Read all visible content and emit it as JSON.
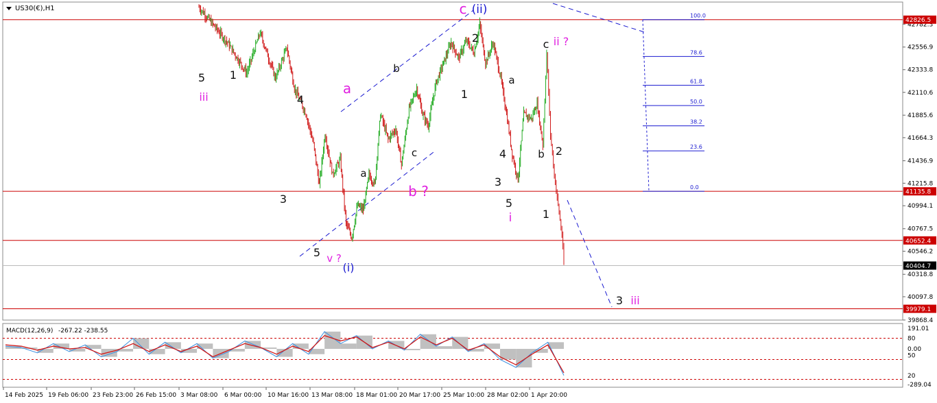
{
  "chart_data": {
    "type": "candlestick",
    "symbol_label": "US30(€),H1",
    "price_axis": {
      "min": 39868,
      "max": 43000,
      "tick_labels": [
        "42782.3",
        "42556.9",
        "42333.8",
        "42110.6",
        "41885.6",
        "41664.3",
        "41436.9",
        "41215.8",
        "40994.1",
        "40767.5",
        "40546.2",
        "40318.8",
        "40097.8",
        "39868.4"
      ]
    },
    "time_axis": {
      "labels": [
        "14 Feb 2025",
        "19 Feb 06:00",
        "23 Feb 23:00",
        "26 Feb 15:00",
        "3 Mar 08:00",
        "6 Mar 00:00",
        "10 Mar 16:00",
        "13 Mar 08:00",
        "18 Mar 01:00",
        "20 Mar 17:00",
        "25 Mar 10:00",
        "28 Mar 02:00",
        "1 Apr 20:00"
      ]
    },
    "horizontal_levels": [
      {
        "price": 42826.5,
        "label": "42826.5",
        "color": "#cc0000"
      },
      {
        "price": 41135.8,
        "label": "41135.8",
        "color": "#cc0000"
      },
      {
        "price": 40652.4,
        "label": "40652.4",
        "color": "#cc0000"
      },
      {
        "price": 39979.1,
        "label": "39979.1",
        "color": "#cc0000"
      }
    ],
    "current_price": {
      "price": 40404.7,
      "label": "40404.7"
    },
    "fibonacci": {
      "levels": [
        {
          "ratio": "100.0",
          "price": 42826.5
        },
        {
          "ratio": "78.6",
          "price": 42464.6
        },
        {
          "ratio": "61.8",
          "price": 42180.5
        },
        {
          "ratio": "50.0",
          "price": 41981.1
        },
        {
          "ratio": "38.2",
          "price": 41781.2
        },
        {
          "ratio": "23.6",
          "price": 41534.3
        },
        {
          "ratio": "0.0",
          "price": 41135.8
        }
      ]
    },
    "wave_labels": [
      {
        "text": "5",
        "color": "#111111"
      },
      {
        "text": "iii",
        "color": "#e020e0"
      },
      {
        "text": "1",
        "color": "#111111"
      },
      {
        "text": "4",
        "color": "#111111"
      },
      {
        "text": "3",
        "color": "#111111"
      },
      {
        "text": "5",
        "color": "#111111"
      },
      {
        "text": "v ?",
        "color": "#e020e0"
      },
      {
        "text": "(i)",
        "color": "#1a1ad0"
      },
      {
        "text": "a",
        "color": "#e020e0"
      },
      {
        "text": "a",
        "color": "#111111"
      },
      {
        "text": "b",
        "color": "#111111"
      },
      {
        "text": "c",
        "color": "#111111"
      },
      {
        "text": "b ?",
        "color": "#e020e0"
      },
      {
        "text": "c",
        "color": "#e020e0"
      },
      {
        "text": "(ii)",
        "color": "#1a1ad0"
      },
      {
        "text": "2",
        "color": "#111111"
      },
      {
        "text": "1",
        "color": "#111111"
      },
      {
        "text": "a",
        "color": "#111111"
      },
      {
        "text": "4",
        "color": "#111111"
      },
      {
        "text": "3",
        "color": "#111111"
      },
      {
        "text": "5",
        "color": "#111111"
      },
      {
        "text": "i",
        "color": "#e020e0"
      },
      {
        "text": "c",
        "color": "#111111"
      },
      {
        "text": "ii ?",
        "color": "#e020e0"
      },
      {
        "text": "b",
        "color": "#111111"
      },
      {
        "text": "2",
        "color": "#111111"
      },
      {
        "text": "1",
        "color": "#111111"
      },
      {
        "text": "3",
        "color": "#111111"
      },
      {
        "text": "iii",
        "color": "#e020e0"
      }
    ],
    "price_path": [
      [
        0.0,
        42950
      ],
      [
        1.5,
        42600
      ],
      [
        2.5,
        42300
      ],
      [
        3.2,
        42700
      ],
      [
        4.0,
        42250
      ],
      [
        4.6,
        42550
      ],
      [
        5.0,
        42150
      ],
      [
        5.6,
        41900
      ],
      [
        6.0,
        41600
      ],
      [
        6.3,
        41200
      ],
      [
        6.6,
        41700
      ],
      [
        7.0,
        41300
      ],
      [
        7.4,
        41450
      ],
      [
        7.7,
        40820
      ],
      [
        8.0,
        40680
      ],
      [
        8.3,
        41000
      ],
      [
        8.6,
        40950
      ],
      [
        8.9,
        41300
      ],
      [
        9.2,
        41200
      ],
      [
        9.5,
        41900
      ],
      [
        9.9,
        41650
      ],
      [
        10.3,
        41750
      ],
      [
        10.6,
        41400
      ],
      [
        11.0,
        41950
      ],
      [
        11.4,
        42150
      ],
      [
        11.7,
        41900
      ],
      [
        12.0,
        41780
      ],
      [
        12.4,
        42200
      ],
      [
        12.8,
        42400
      ],
      [
        13.2,
        42600
      ],
      [
        13.6,
        42450
      ],
      [
        14.0,
        42620
      ],
      [
        14.4,
        42500
      ],
      [
        14.7,
        42780
      ],
      [
        15.0,
        42400
      ],
      [
        15.4,
        42600
      ],
      [
        15.8,
        42250
      ],
      [
        16.1,
        41900
      ],
      [
        16.4,
        41500
      ],
      [
        16.7,
        41250
      ],
      [
        17.0,
        41900
      ],
      [
        17.4,
        41850
      ],
      [
        17.7,
        42000
      ],
      [
        18.0,
        41600
      ],
      [
        18.2,
        42500
      ],
      [
        18.4,
        41700
      ],
      [
        18.6,
        41300
      ],
      [
        18.8,
        41000
      ],
      [
        19.0,
        40700
      ],
      [
        19.1,
        40420
      ]
    ],
    "indicator": {
      "name": "MACD(12,26,9)",
      "values_label": "-267.22 -238.55",
      "scale_labels": [
        "191.01",
        "80",
        "0.00",
        "50",
        "20",
        "-289.04"
      ],
      "main_line": [
        20,
        10,
        -30,
        40,
        -20,
        30,
        -60,
        -20,
        80,
        -40,
        50,
        -30,
        40,
        -70,
        -20,
        60,
        10,
        -60,
        40,
        -40,
        130,
        40,
        100,
        0,
        60,
        -10,
        110,
        20,
        90,
        -20,
        40,
        -80,
        -140,
        -30,
        50,
        -200
      ],
      "signal_line": [
        30,
        20,
        -10,
        20,
        0,
        10,
        -40,
        -10,
        40,
        -20,
        30,
        -20,
        20,
        -60,
        -10,
        40,
        10,
        -40,
        20,
        -20,
        100,
        60,
        90,
        10,
        50,
        0,
        90,
        30,
        80,
        -10,
        30,
        -60,
        -120,
        -40,
        30,
        -180
      ]
    }
  }
}
